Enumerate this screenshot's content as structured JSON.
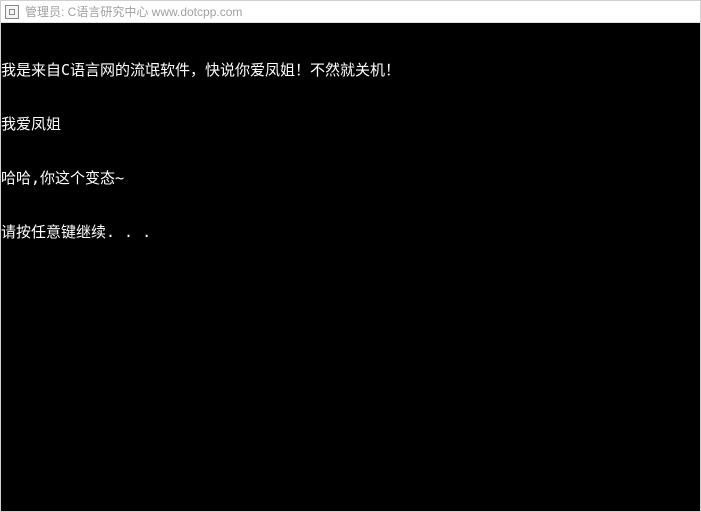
{
  "titlebar": {
    "text": "管理员:  C语言研究中心 www.dotcpp.com"
  },
  "console": {
    "lines": [
      "我是来自C语言网的流氓软件，快说你爱凤姐！不然就关机！",
      "我爱凤姐",
      "哈哈,你这个变态~",
      "请按任意键继续. . ."
    ]
  }
}
